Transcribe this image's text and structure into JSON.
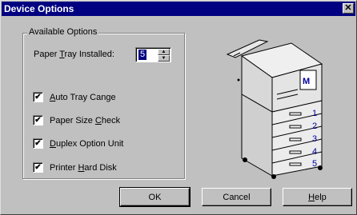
{
  "window": {
    "title": "Device Options",
    "close_glyph": "✕"
  },
  "group": {
    "legend": "Available Options"
  },
  "paper_tray": {
    "label_pre": "Paper ",
    "label_mnemonic": "T",
    "label_post": "ray Installed:",
    "value": "5"
  },
  "options": [
    {
      "pre": "",
      "mnemonic": "A",
      "post": "uto Tray Cange",
      "checked": true
    },
    {
      "pre": "Paper Size ",
      "mnemonic": "C",
      "post": "heck",
      "checked": true
    },
    {
      "pre": "",
      "mnemonic": "D",
      "post": "uplex Option Unit",
      "checked": true
    },
    {
      "pre": "Printer ",
      "mnemonic": "H",
      "post": "ard Disk",
      "checked": true
    }
  ],
  "check_glyph": "✔",
  "buttons": {
    "ok": "OK",
    "cancel": "Cancel",
    "help_mnemonic": "H",
    "help_post": "elp"
  },
  "printer_image": {
    "logo_letter": "M",
    "tray_numbers": [
      "1",
      "2",
      "3",
      "4",
      "5"
    ],
    "accent_color": "#0000a0"
  }
}
